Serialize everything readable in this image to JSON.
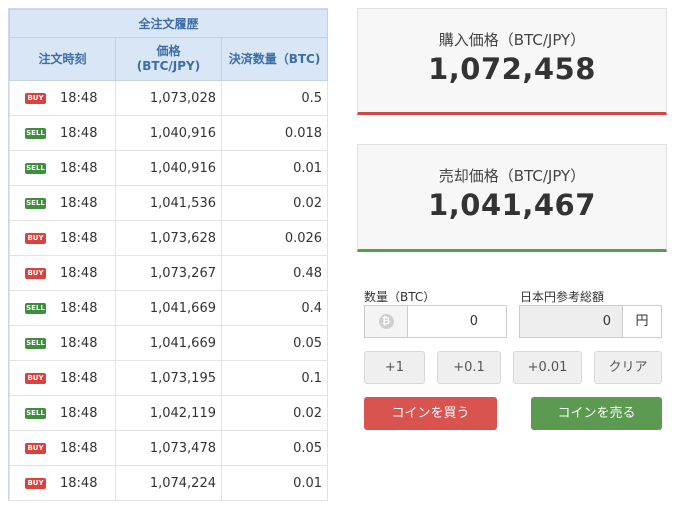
{
  "history": {
    "title": "全注文履歴",
    "columns": {
      "time": "注文時刻",
      "price_line1": "価格",
      "price_line2": "(BTC/JPY)",
      "qty": "決済数量（BTC)"
    },
    "rows": [
      {
        "side": "BUY",
        "time": "18:48",
        "price": "1,073,028",
        "qty": "0.5"
      },
      {
        "side": "SELL",
        "time": "18:48",
        "price": "1,040,916",
        "qty": "0.018"
      },
      {
        "side": "SELL",
        "time": "18:48",
        "price": "1,040,916",
        "qty": "0.01"
      },
      {
        "side": "SELL",
        "time": "18:48",
        "price": "1,041,536",
        "qty": "0.02"
      },
      {
        "side": "BUY",
        "time": "18:48",
        "price": "1,073,628",
        "qty": "0.026"
      },
      {
        "side": "BUY",
        "time": "18:48",
        "price": "1,073,267",
        "qty": "0.48"
      },
      {
        "side": "SELL",
        "time": "18:48",
        "price": "1,041,669",
        "qty": "0.4"
      },
      {
        "side": "SELL",
        "time": "18:48",
        "price": "1,041,669",
        "qty": "0.05"
      },
      {
        "side": "BUY",
        "time": "18:48",
        "price": "1,073,195",
        "qty": "0.1"
      },
      {
        "side": "SELL",
        "time": "18:48",
        "price": "1,042,119",
        "qty": "0.02"
      },
      {
        "side": "BUY",
        "time": "18:48",
        "price": "1,073,478",
        "qty": "0.05"
      },
      {
        "side": "BUY",
        "time": "18:48",
        "price": "1,074,224",
        "qty": "0.01"
      }
    ]
  },
  "buy_price": {
    "label": "購入価格（BTC/JPY）",
    "value": "1,072,458"
  },
  "sell_price": {
    "label": "売却価格（BTC/JPY）",
    "value": "1,041,467"
  },
  "form": {
    "qty_label": "数量（BTC）",
    "qty_value": "0",
    "btc_icon": "bitcoin-icon",
    "jpy_label": "日本円参考総額",
    "jpy_value": "0",
    "jpy_unit": "円",
    "steps": [
      "+1",
      "+0.1",
      "+0.01",
      "クリア"
    ],
    "buy_button": "コインを買う",
    "sell_button": "コインを売る"
  },
  "colors": {
    "buy": "#d9534f",
    "sell": "#5b9a50",
    "header_bg": "#d9e6f5",
    "header_text": "#3d6ea8"
  }
}
